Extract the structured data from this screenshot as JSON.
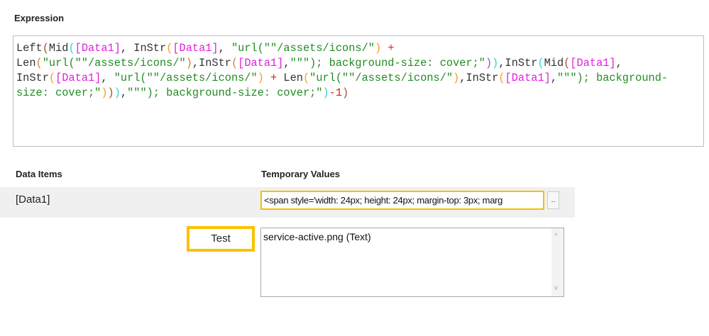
{
  "expression_label": "Expression",
  "expression_tokens": [
    {
      "t": "Left",
      "c": "#333333"
    },
    {
      "t": "(",
      "c": "#a0522d"
    },
    {
      "t": "Mid",
      "c": "#333333"
    },
    {
      "t": "(",
      "c": "#2ad4d4"
    },
    {
      "t": "[Data1]",
      "c": "#e020e0"
    },
    {
      "t": ", InStr",
      "c": "#333333"
    },
    {
      "t": "(",
      "c": "#f0a020"
    },
    {
      "t": "[Data1]",
      "c": "#e020e0"
    },
    {
      "t": ", ",
      "c": "#333333"
    },
    {
      "t": "\"url(\"\"/assets/icons/\"",
      "c": "#228b22"
    },
    {
      "t": ")",
      "c": "#f0a020"
    },
    {
      "t": " ",
      "c": "#333333"
    },
    {
      "t": "+",
      "c": "#e02020"
    },
    {
      "t": "\n",
      "c": "#333333"
    },
    {
      "t": "Len",
      "c": "#333333"
    },
    {
      "t": "(",
      "c": "#d08030"
    },
    {
      "t": "\"url(\"\"/assets/icons/\"",
      "c": "#228b22"
    },
    {
      "t": ")",
      "c": "#d08030"
    },
    {
      "t": ",InStr",
      "c": "#333333"
    },
    {
      "t": "(",
      "c": "#d08030"
    },
    {
      "t": "[Data1]",
      "c": "#e020e0"
    },
    {
      "t": ",",
      "c": "#333333"
    },
    {
      "t": "\"\"\"); background-size: cover;\"",
      "c": "#228b22"
    },
    {
      "t": ")",
      "c": "#9050c0"
    },
    {
      "t": ")",
      "c": "#2ad4d4"
    },
    {
      "t": ",InStr",
      "c": "#333333"
    },
    {
      "t": "(",
      "c": "#2ad4d4"
    },
    {
      "t": "Mid",
      "c": "#333333"
    },
    {
      "t": "(",
      "c": "#a0522d"
    },
    {
      "t": "[Data1]",
      "c": "#e020e0"
    },
    {
      "t": ",",
      "c": "#333333"
    },
    {
      "t": "\n",
      "c": "#333333"
    },
    {
      "t": "InStr",
      "c": "#333333"
    },
    {
      "t": "(",
      "c": "#f0a020"
    },
    {
      "t": "[Data1]",
      "c": "#e020e0"
    },
    {
      "t": ", ",
      "c": "#333333"
    },
    {
      "t": "\"url(\"\"/assets/icons/\"",
      "c": "#228b22"
    },
    {
      "t": ")",
      "c": "#f0a020"
    },
    {
      "t": " ",
      "c": "#333333"
    },
    {
      "t": "+",
      "c": "#e02020"
    },
    {
      "t": " Len",
      "c": "#333333"
    },
    {
      "t": "(",
      "c": "#f0a020"
    },
    {
      "t": "\"url(\"\"/assets/icons/\"",
      "c": "#228b22"
    },
    {
      "t": ")",
      "c": "#f0a020"
    },
    {
      "t": ",InStr",
      "c": "#333333"
    },
    {
      "t": "(",
      "c": "#f0a020"
    },
    {
      "t": "[Data1]",
      "c": "#e020e0"
    },
    {
      "t": ",",
      "c": "#333333"
    },
    {
      "t": "\"\"\"); background-",
      "c": "#228b22"
    },
    {
      "t": "\n",
      "c": "#333333"
    },
    {
      "t": "size: cover;\"",
      "c": "#228b22"
    },
    {
      "t": ")",
      "c": "#f0a020"
    },
    {
      "t": ")",
      "c": "#a0522d"
    },
    {
      "t": ")",
      "c": "#2ad4d4"
    },
    {
      "t": ",",
      "c": "#333333"
    },
    {
      "t": "\"\"\"); background-size: cover;\"",
      "c": "#228b22"
    },
    {
      "t": ")",
      "c": "#2ad4d4"
    },
    {
      "t": "-1",
      "c": "#e02020"
    },
    {
      "t": ")",
      "c": "#a0522d"
    }
  ],
  "data_items_header": "Data Items",
  "temp_values_header": "Temporary Values",
  "row": {
    "name": "[Data1]",
    "value": "<span style='width: 24px; height: 24px; margin-top: 3px; marg",
    "browse_label": ".."
  },
  "test_label": "Test",
  "result_text": "service-active.png (Text)",
  "scroll_up": "^",
  "scroll_down": "v"
}
